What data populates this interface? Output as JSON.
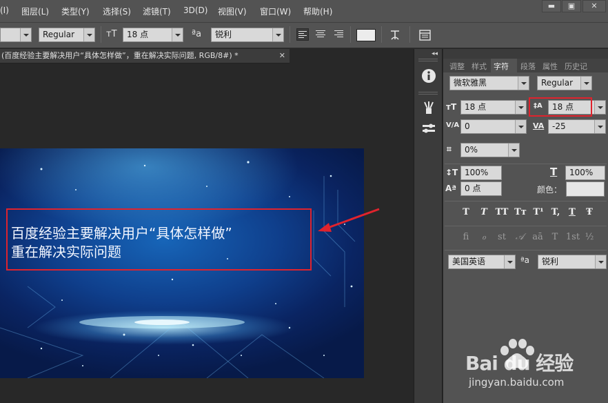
{
  "menu": {
    "items": [
      "(I)",
      "图层(L)",
      "类型(Y)",
      "选择(S)",
      "滤镜(T)",
      "3D(D)",
      "视图(V)",
      "窗口(W)",
      "帮助(H)"
    ],
    "win_min": "▬",
    "win_max": "▣",
    "win_close": "✕"
  },
  "options": {
    "font_style": "Regular",
    "font_size": "18 点",
    "aa_icon": "ªa",
    "aa_mode": "锐利",
    "size_icon": "тT"
  },
  "document": {
    "tab_title": "(百度经验主要解决用户“具体怎样做”，重在解决实际问题, RGB/8#) *",
    "close": "✕",
    "artwork_line1": "百度经验主要解决用户“具体怎样做”",
    "artwork_line2": "重在解决实际问题"
  },
  "panel": {
    "collapse": "◂◂",
    "tabs": [
      "调整",
      "样式",
      "字符",
      "段落",
      "属性",
      "历史记"
    ],
    "active_tab": "字符",
    "font_family": "微软雅黑",
    "font_style": "Regular",
    "font_size": "18 点",
    "leading": "18 点",
    "kerning": "0",
    "tracking": "-25",
    "tsume": "0%",
    "vertical_scale": "100%",
    "horizontal_scale": "100%",
    "baseline_shift": "0 点",
    "color_label": "颜色：",
    "language": "美国英语",
    "aa_icon": "ªa",
    "aa_mode": "锐利",
    "style_buttons": [
      "T",
      "T",
      "TT",
      "Tт",
      "T¹",
      "T,",
      "T",
      "Ŧ"
    ],
    "opentype_buttons": [
      "fi",
      "ℴ",
      "st",
      "𝒜",
      "aā",
      "T",
      "1st",
      "½"
    ],
    "icons": {
      "size": "тT",
      "leading": "‡A",
      "kerning": "V/A",
      "tracking": "VA",
      "tsume": "⌗",
      "vscale": "↕T",
      "hscale": "T",
      "baseline": "Aª"
    }
  },
  "watermark": {
    "logo": "Bai du 经验",
    "url": "jingyan.baidu.com"
  },
  "colors": {
    "ui_dark": "#282828",
    "panel": "#535353",
    "highlight_red": "#e0232d",
    "artwork_blue": "#0f3f8c"
  }
}
